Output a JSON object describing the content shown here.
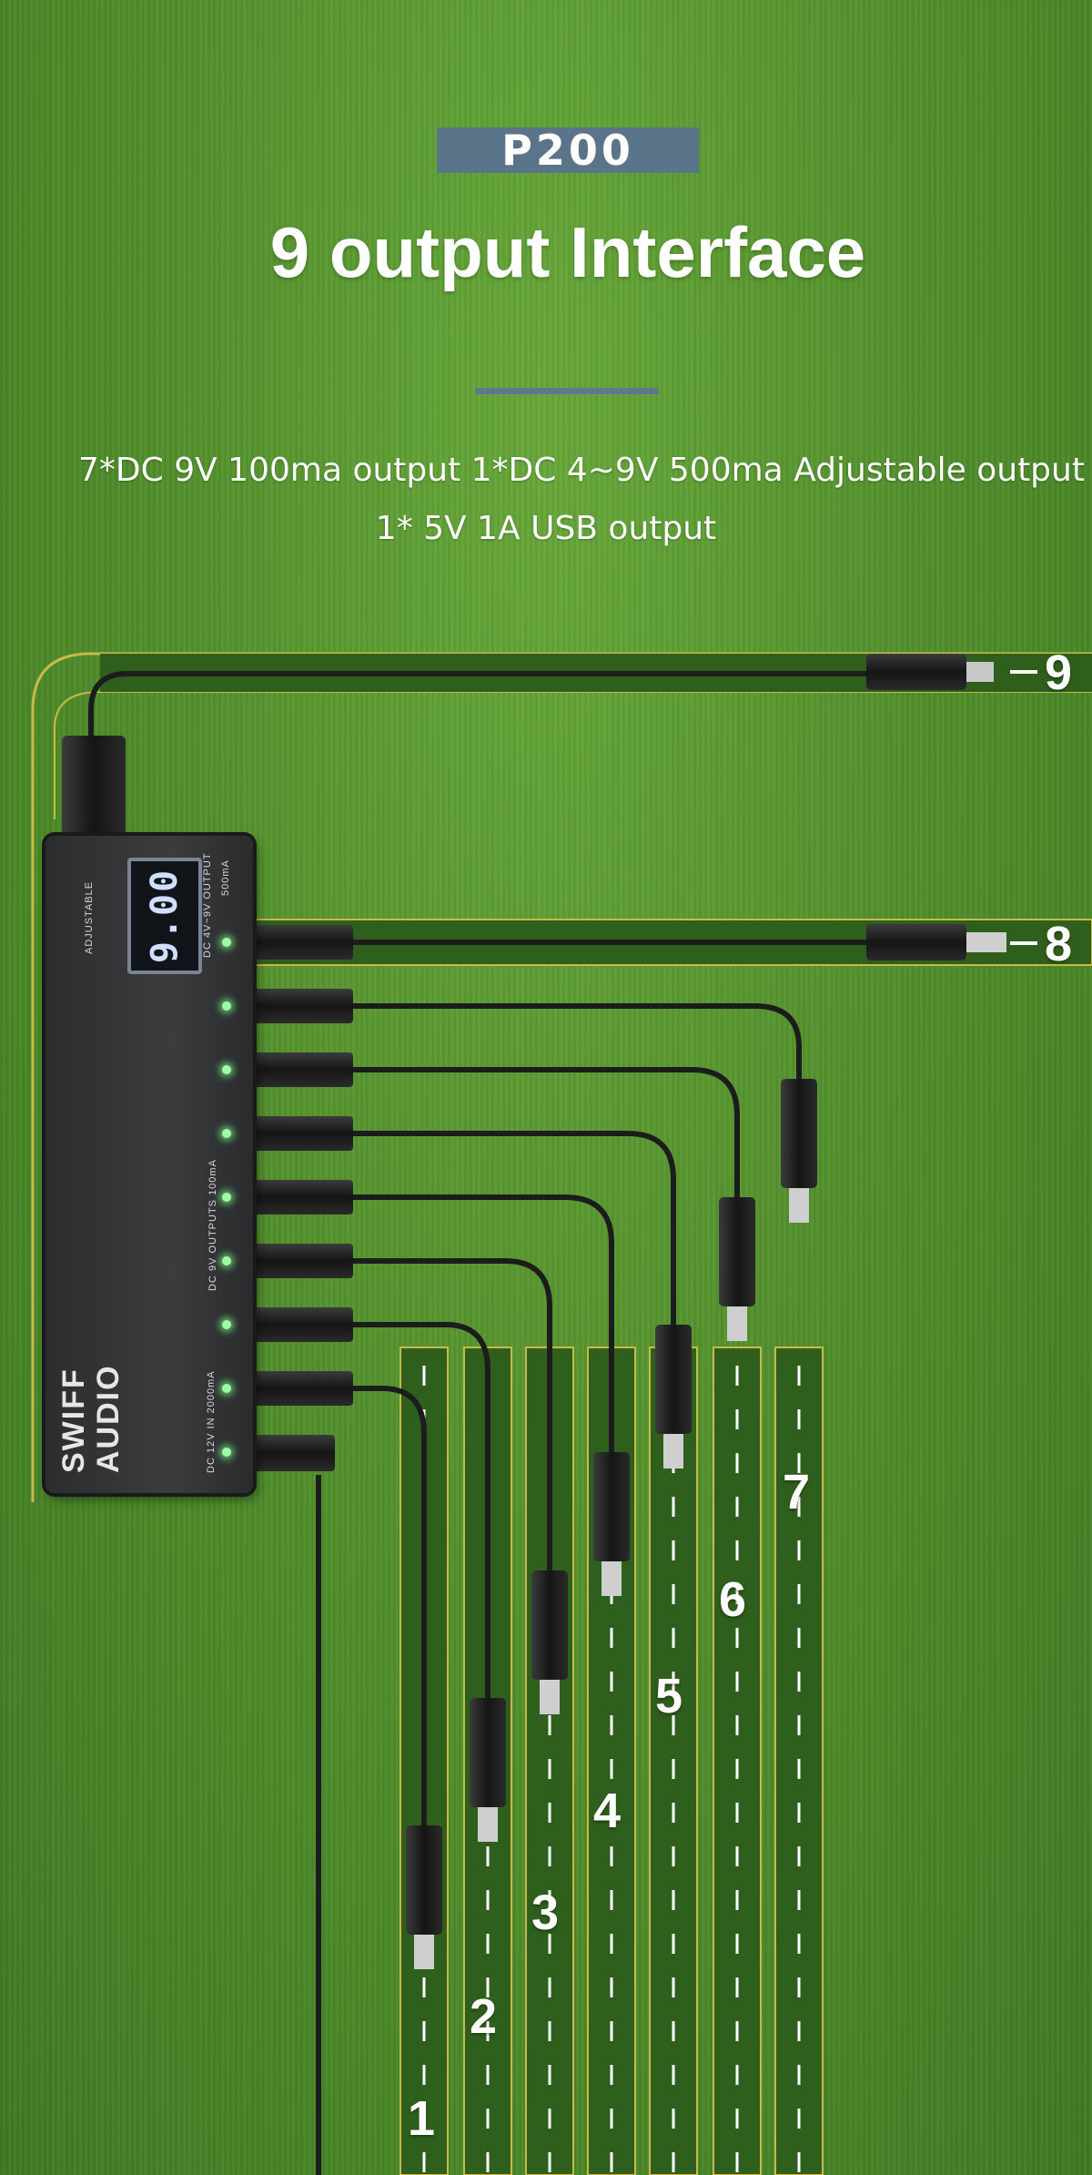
{
  "model_badge": "P200",
  "title": "9 output Interface",
  "spec_line_1": "7*DC 9V 100ma output   1*DC 4~9V 500ma Adjustable output",
  "spec_line_2": "1* 5V 1A USB output",
  "device": {
    "display_value": "9.00",
    "adjustable_label": "ADJUSTABLE",
    "output_adj_label": "DC 4V~9V OUTPUT",
    "output_adj_current": "500mA",
    "outputs_label": "DC 9V   OUTPUTS   100mA",
    "input_label": "DC 12V IN 2000mA",
    "brand_line1": "SWIFF",
    "brand_line2": "AUDIO"
  },
  "output_numbers": [
    "1",
    "2",
    "3",
    "4",
    "5",
    "6",
    "7",
    "8",
    "9"
  ],
  "colors": {
    "grass": "#4f8d2a",
    "badge": "#5a7589",
    "track": "#2f5f1c",
    "track_border": "#c9b84a"
  }
}
